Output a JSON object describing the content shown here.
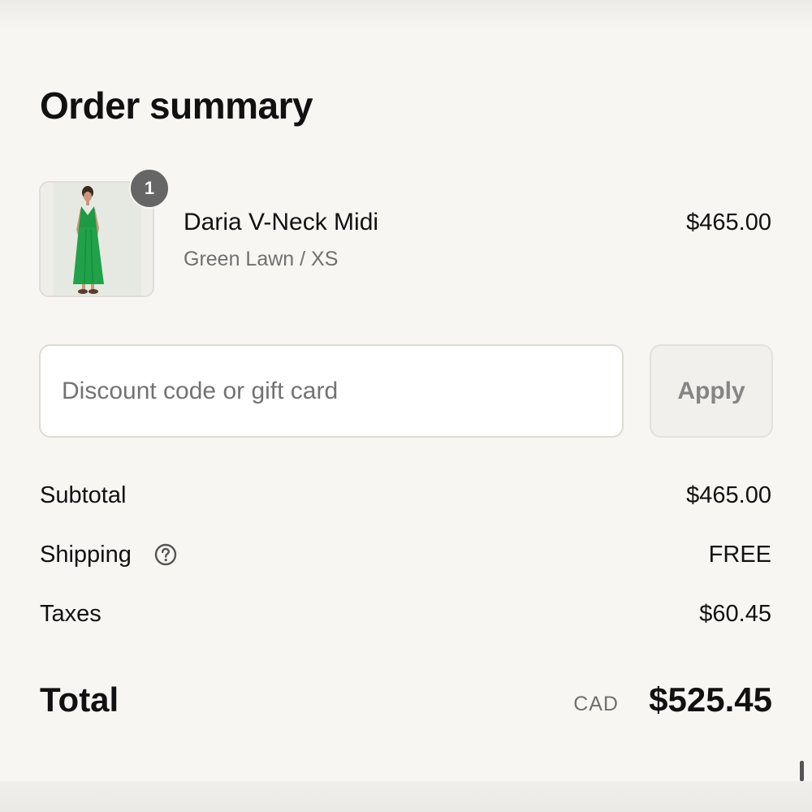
{
  "page": {
    "title": "Order summary"
  },
  "product": {
    "name": "Daria V-Neck Midi",
    "variant": "Green Lawn / XS",
    "price": "$465.00",
    "quantity": "1",
    "image_icon": "product-photo-green-dress"
  },
  "discount": {
    "placeholder": "Discount code or gift card",
    "value": "",
    "apply_label": "Apply"
  },
  "summary": {
    "subtotal_label": "Subtotal",
    "subtotal_value": "$465.00",
    "shipping_label": "Shipping",
    "shipping_value": "FREE",
    "shipping_help_icon": "question-circle-icon",
    "taxes_label": "Taxes",
    "taxes_value": "$60.45"
  },
  "total": {
    "label": "Total",
    "currency": "CAD",
    "value": "$525.45"
  },
  "colors": {
    "background": "#f8f6f3",
    "badge": "#666666",
    "dress_green": "#1e9a45",
    "muted_text": "#707070"
  }
}
